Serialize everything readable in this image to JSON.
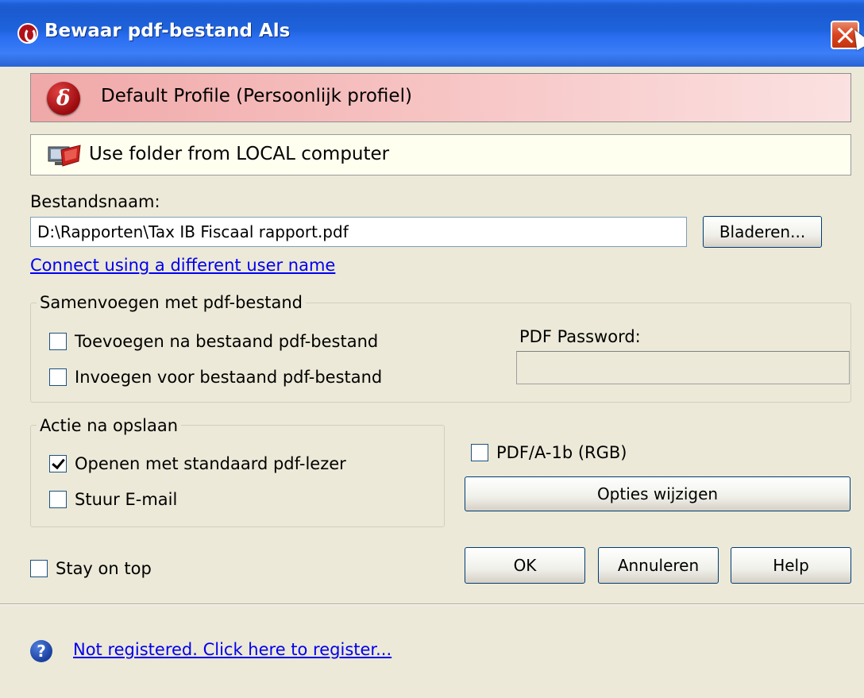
{
  "window": {
    "title": "Bewaar pdf-bestand Als"
  },
  "profile": {
    "name": "Default Profile (Persoonlijk profiel)"
  },
  "location": {
    "text": "Use folder from LOCAL computer"
  },
  "filename": {
    "label": "Bestandsnaam:",
    "value": "D:\\Rapporten\\Tax IB Fiscaal rapport.pdf",
    "browse_label": "Bladeren...",
    "connect_link": "Connect using a different user name"
  },
  "merge": {
    "title": "Samenvoegen met pdf-bestand",
    "append_label": "Toevoegen na bestaand pdf-bestand",
    "append_checked": false,
    "insert_label": "Invoegen voor bestaand pdf-bestand",
    "insert_checked": false,
    "password_label": "PDF Password:"
  },
  "after_save": {
    "title": "Actie na opslaan",
    "open_label": "Openen met standaard pdf-lezer",
    "open_checked": true,
    "email_label": "Stuur E-mail",
    "email_checked": false
  },
  "pdfa": {
    "label": "PDF/A-1b (RGB)",
    "checked": false
  },
  "options_button": "Opties wijzigen",
  "stay_on_top": {
    "label": "Stay on top",
    "checked": false
  },
  "buttons": {
    "ok": "OK",
    "cancel": "Annuleren",
    "help": "Help"
  },
  "footer": {
    "register_link": "Not registered. Click here to register..."
  },
  "colors": {
    "title_bar": "#1e5fd6",
    "profile_bar": "#f7c4c4",
    "dialog_bg": "#ece9d8",
    "link": "#0000ee"
  }
}
